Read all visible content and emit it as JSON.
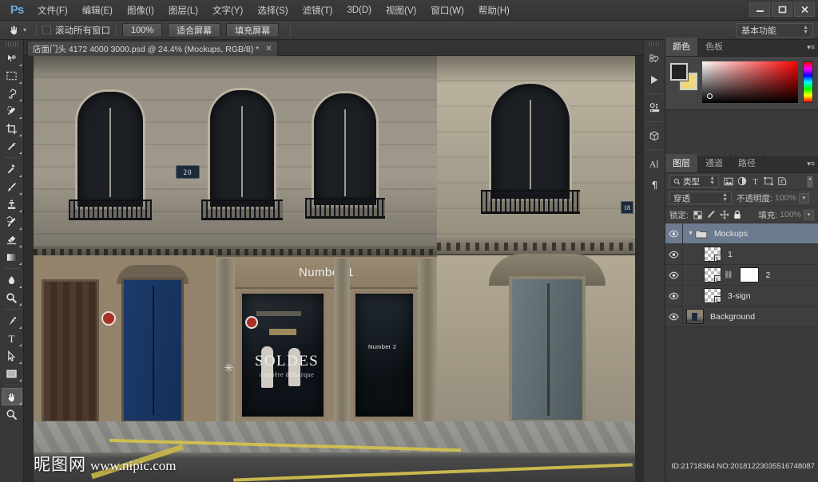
{
  "app": {
    "logo": "Ps",
    "title_bar_controls": {
      "minimize": "—",
      "maximize": "❐",
      "close": "✕"
    }
  },
  "menubar": {
    "items": [
      {
        "label": "文件(F)",
        "name": "menu-file"
      },
      {
        "label": "编辑(E)",
        "name": "menu-edit"
      },
      {
        "label": "图像(I)",
        "name": "menu-image"
      },
      {
        "label": "图层(L)",
        "name": "menu-layer"
      },
      {
        "label": "文字(Y)",
        "name": "menu-type"
      },
      {
        "label": "选择(S)",
        "name": "menu-select"
      },
      {
        "label": "滤镜(T)",
        "name": "menu-filter"
      },
      {
        "label": "3D(D)",
        "name": "menu-3d"
      },
      {
        "label": "视图(V)",
        "name": "menu-view"
      },
      {
        "label": "窗口(W)",
        "name": "menu-window"
      },
      {
        "label": "帮助(H)",
        "name": "menu-help"
      }
    ]
  },
  "options_bar": {
    "active_tool_icon": "hand-icon",
    "scroll_all_windows_label": "滚动所有窗口",
    "scroll_all_windows_checked": false,
    "buttons": [
      {
        "label": "100%",
        "name": "zoom-100-button"
      },
      {
        "label": "适合屏幕",
        "name": "fit-screen-button"
      },
      {
        "label": "填充屏幕",
        "name": "fill-screen-button"
      }
    ],
    "workspace": {
      "value": "基本功能",
      "name": "workspace-selector"
    }
  },
  "toolbar": {
    "tools": [
      {
        "name": "move-tool",
        "label": "移动工具",
        "icon": "move-icon",
        "active": false,
        "has_flyout": true
      },
      {
        "name": "marquee-tool",
        "label": "矩形选框工具",
        "icon": "marquee-icon",
        "active": false,
        "has_flyout": true
      },
      {
        "name": "lasso-tool",
        "label": "套索工具",
        "icon": "lasso-icon",
        "active": false,
        "has_flyout": true
      },
      {
        "name": "quick-selection-tool",
        "label": "快速选择工具",
        "icon": "quick-selection-icon",
        "active": false,
        "has_flyout": true
      },
      {
        "name": "crop-tool",
        "label": "裁剪工具",
        "icon": "crop-icon",
        "active": false,
        "has_flyout": true
      },
      {
        "name": "eyedropper-tool",
        "label": "吸管工具",
        "icon": "eyedropper-icon",
        "active": false,
        "has_flyout": true
      },
      {
        "name": "healing-brush-tool",
        "label": "污点修复画笔工具",
        "icon": "healing-brush-icon",
        "active": false,
        "has_flyout": true
      },
      {
        "name": "brush-tool",
        "label": "画笔工具",
        "icon": "brush-icon",
        "active": false,
        "has_flyout": true
      },
      {
        "name": "clone-stamp-tool",
        "label": "仿制图章工具",
        "icon": "clone-stamp-icon",
        "active": false,
        "has_flyout": true
      },
      {
        "name": "history-brush-tool",
        "label": "历史记录画笔工具",
        "icon": "history-brush-icon",
        "active": false,
        "has_flyout": true
      },
      {
        "name": "eraser-tool",
        "label": "橡皮擦工具",
        "icon": "eraser-icon",
        "active": false,
        "has_flyout": true
      },
      {
        "name": "gradient-tool",
        "label": "渐变工具",
        "icon": "gradient-icon",
        "active": false,
        "has_flyout": true
      },
      {
        "name": "blur-tool",
        "label": "模糊工具",
        "icon": "blur-drop-icon",
        "active": false,
        "has_flyout": true
      },
      {
        "name": "dodge-tool",
        "label": "减淡工具",
        "icon": "dodge-icon",
        "active": false,
        "has_flyout": true
      },
      {
        "name": "pen-tool",
        "label": "钢笔工具",
        "icon": "pen-icon",
        "active": false,
        "has_flyout": true
      },
      {
        "name": "type-tool",
        "label": "横排文字工具",
        "icon": "type-icon",
        "active": false,
        "has_flyout": true
      },
      {
        "name": "path-selection-tool",
        "label": "路径选择工具",
        "icon": "path-selection-icon",
        "active": false,
        "has_flyout": true
      },
      {
        "name": "rectangle-tool",
        "label": "矩形工具",
        "icon": "rectangle-icon",
        "active": false,
        "has_flyout": true
      },
      {
        "name": "hand-tool",
        "label": "抓手工具",
        "icon": "hand-icon",
        "active": true,
        "has_flyout": true
      },
      {
        "name": "zoom-tool",
        "label": "缩放工具",
        "icon": "zoom-icon",
        "active": false,
        "has_flyout": false
      }
    ]
  },
  "document": {
    "tab_title": "店面门头 4172 4000 3000.psd @ 24.4% (Mockups, RGB/8) *",
    "close_glyph": "✕",
    "zoom_level": "24.4%",
    "color_mode": "RGB/8",
    "canvas_text": {
      "shop_sign": "Number 1",
      "door_sign": "Number 2",
      "window_sale": "SOLDES",
      "window_sale_sub": "dernière démarque",
      "address_plaque_left": "20",
      "address_plaque_right": "18"
    }
  },
  "watermark": {
    "site_cn": "昵图网",
    "site_url": "www.nipic.com",
    "id_text": "ID:21718364 NO:20181223035516748087"
  },
  "icon_dock": {
    "buttons": [
      {
        "name": "history-panel-icon",
        "label": "历史记录"
      },
      {
        "name": "actions-panel-icon",
        "label": "动作"
      },
      {
        "name": "properties-panel-icon",
        "label": "属性"
      },
      {
        "name": "3d-panel-icon",
        "label": "3D"
      },
      {
        "name": "character-panel-icon",
        "label": "字符"
      },
      {
        "name": "paragraph-panel-icon",
        "label": "段落"
      }
    ]
  },
  "color_panel": {
    "tabs": [
      {
        "label": "颜色",
        "name": "tab-color",
        "active": true
      },
      {
        "label": "色板",
        "name": "tab-swatches",
        "active": false
      }
    ],
    "foreground_color": "#232323",
    "background_color": "#f0d878",
    "menu_glyph": "▾≡"
  },
  "layers_panel": {
    "tabs": [
      {
        "label": "图层",
        "name": "tab-layers",
        "active": true
      },
      {
        "label": "通道",
        "name": "tab-channels",
        "active": false
      },
      {
        "label": "路径",
        "name": "tab-paths",
        "active": false
      }
    ],
    "menu_glyph": "▾≡",
    "filter": {
      "label": "类型",
      "icon": "search-icon"
    },
    "filter_icons": [
      "pixel-filter-icon",
      "adjustment-filter-icon",
      "type-filter-icon",
      "shape-filter-icon",
      "smart-object-filter-icon"
    ],
    "filter_toggle": "filter-toggle-icon",
    "blend_mode": "穿透",
    "opacity_label": "不透明度:",
    "opacity_value": "100%",
    "lock_label": "锁定:",
    "lock_icons": [
      "lock-transparent-icon",
      "lock-image-icon",
      "lock-position-icon",
      "lock-all-icon"
    ],
    "fill_label": "填充:",
    "fill_value": "100%",
    "layers": [
      {
        "name": "Mockups",
        "type": "group",
        "selected": true,
        "visible": true,
        "expanded": true,
        "has_mask": false,
        "indent": 0
      },
      {
        "name": "1",
        "type": "smart-object",
        "selected": false,
        "visible": true,
        "has_mask": false,
        "indent": 1
      },
      {
        "name": "2",
        "type": "smart-object",
        "selected": false,
        "visible": true,
        "has_mask": true,
        "indent": 1
      },
      {
        "name": "3-sign",
        "type": "smart-object",
        "selected": false,
        "visible": true,
        "has_mask": false,
        "indent": 1
      },
      {
        "name": "Background",
        "type": "image",
        "selected": false,
        "visible": true,
        "has_mask": false,
        "indent": 0
      }
    ]
  }
}
